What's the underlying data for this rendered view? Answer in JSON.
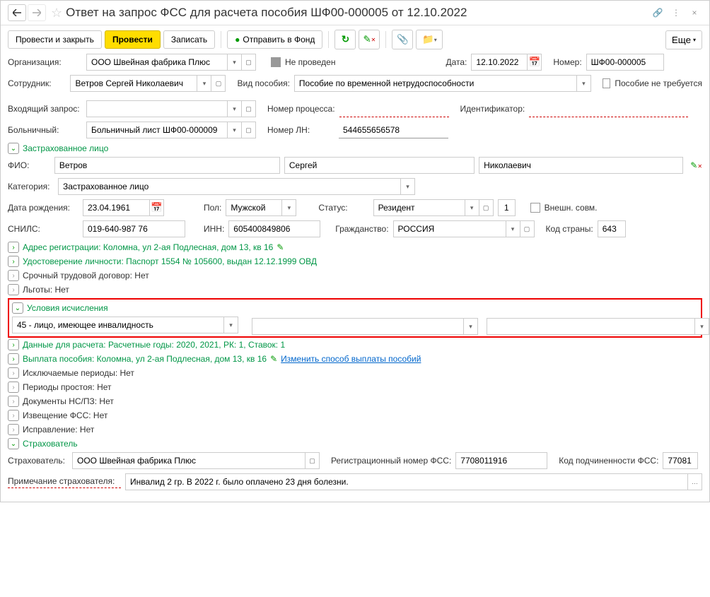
{
  "header": {
    "title": "Ответ на запрос ФСС для расчета пособия ШФ00-000005 от 12.10.2022"
  },
  "toolbar": {
    "post_close": "Провести и закрыть",
    "post": "Провести",
    "save": "Записать",
    "send": "Отправить в Фонд",
    "more": "Еще"
  },
  "form": {
    "org_label": "Организация:",
    "org_value": "ООО Швейная фабрика Плюс",
    "status": "Не проведен",
    "date_label": "Дата:",
    "date_value": "12.10.2022",
    "number_label": "Номер:",
    "number_value": "ШФ00-000005",
    "employee_label": "Сотрудник:",
    "employee_value": "Ветров Сергей Николаевич",
    "benefit_type_label": "Вид пособия:",
    "benefit_type_value": "Пособие по временной нетрудоспособности",
    "no_benefit_label": "Пособие не требуется",
    "incoming_req_label": "Входящий запрос:",
    "process_num_label": "Номер процесса:",
    "identifier_label": "Идентификатор:",
    "sickleave_label": "Больничный:",
    "sickleave_value": "Больничный лист ШФ00-000009",
    "ln_number_label": "Номер ЛН:",
    "ln_number_value": "544655656578"
  },
  "insured": {
    "section": "Застрахованное лицо",
    "fio_label": "ФИО:",
    "surname": "Ветров",
    "name": "Сергей",
    "patronymic": "Николаевич",
    "category_label": "Категория:",
    "category_value": "Застрахованное лицо",
    "birthdate_label": "Дата рождения:",
    "birthdate_value": "23.04.1961",
    "gender_label": "Пол:",
    "gender_value": "Мужской",
    "status_label": "Статус:",
    "status_value": "Резидент",
    "status_code": "1",
    "external_label": "Внешн. совм.",
    "snils_label": "СНИЛС:",
    "snils_value": "019-640-987 76",
    "inn_label": "ИНН:",
    "inn_value": "605400849806",
    "citizenship_label": "Гражданство:",
    "citizenship_value": "РОССИЯ",
    "country_code_label": "Код страны:",
    "country_code_value": "643"
  },
  "sections": {
    "address": "Адрес регистрации: Коломна, ул 2-ая Подлесная, дом 13, кв 16",
    "identity": "Удостоверение личности: Паспорт 1554 № 105600, выдан 12.12.1999 ОВД",
    "contract": "Срочный трудовой договор: Нет",
    "benefits": "Льготы: Нет",
    "conditions_title": "Условия исчисления",
    "condition_value": "45 - лицо, имеющее инвалидность",
    "calc_data": "Данные для расчета: Расчетные годы: 2020, 2021, РК: 1, Ставок: 1",
    "payment": "Выплата пособия: Коломна, ул 2-ая Подлесная, дом 13, кв 16",
    "payment_link": "Изменить способ выплаты пособий",
    "excluded": "Исключаемые периоды: Нет",
    "downtime": "Периоды простоя: Нет",
    "docs": "Документы НС/ПЗ: Нет",
    "notice": "Извещение ФСС: Нет",
    "correction": "Исправление: Нет",
    "insurer_title": "Страхователь"
  },
  "insurer": {
    "label": "Страхователь:",
    "value": "ООО Швейная фабрика Плюс",
    "reg_label": "Регистрационный номер ФСС:",
    "reg_value": "7708011916",
    "sub_label": "Код подчиненности ФСС:",
    "sub_value": "77081",
    "note_label": "Примечание страхователя:",
    "note_value": "Инвалид 2 гр. В 2022 г. было оплачено 23 дня болезни."
  }
}
